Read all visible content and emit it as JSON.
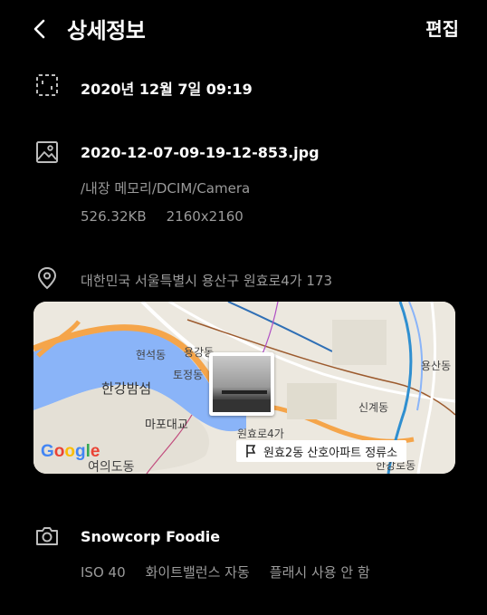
{
  "header": {
    "title": "상세정보",
    "edit_label": "편집"
  },
  "date": {
    "icon": "calendar-icon",
    "text": "2020년 12월 7일 09:19"
  },
  "file": {
    "icon": "image-icon",
    "name": "2020-12-07-09-19-12-853.jpg",
    "path": "/내장 메모리/DCIM/Camera",
    "size": "526.32KB",
    "resolution": "2160x2160"
  },
  "location": {
    "icon": "location-pin-icon",
    "address": "대한민국 서울특별시 용산구 원효로4가 173"
  },
  "map": {
    "labels": {
      "hangang": "한강밤섬",
      "mapo_bridge": "마포대교",
      "yeouido": "여의도동",
      "hyunseok": "현석동",
      "yonggang": "용강동",
      "tojeong": "토정동",
      "wonhyo": "원효로4가",
      "singye": "신계동",
      "yongsan": "용산동",
      "hangang_road": "한강로동"
    },
    "logo": "Google",
    "bus_stop": "원효2동 산호아파트 정류소"
  },
  "camera": {
    "icon": "camera-icon",
    "device": "Snowcorp Foodie",
    "iso": "ISO 40",
    "white_balance": "화이트밸런스 자동",
    "flash": "플래시 사용 안 함"
  }
}
